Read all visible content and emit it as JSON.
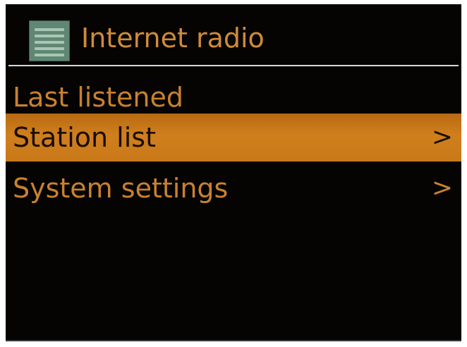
{
  "header": {
    "title": "Internet radio",
    "icon": "menu-list-icon"
  },
  "menu": {
    "items": [
      {
        "label": "Last listened",
        "chevron": "",
        "selected": false
      },
      {
        "label": "Station list",
        "chevron": ">",
        "selected": true
      },
      {
        "label": "System settings",
        "chevron": ">",
        "selected": false
      }
    ]
  },
  "colors": {
    "background": "#050403",
    "text": "#c9812f",
    "highlight": "#c87818",
    "icon": "#5f8773"
  }
}
